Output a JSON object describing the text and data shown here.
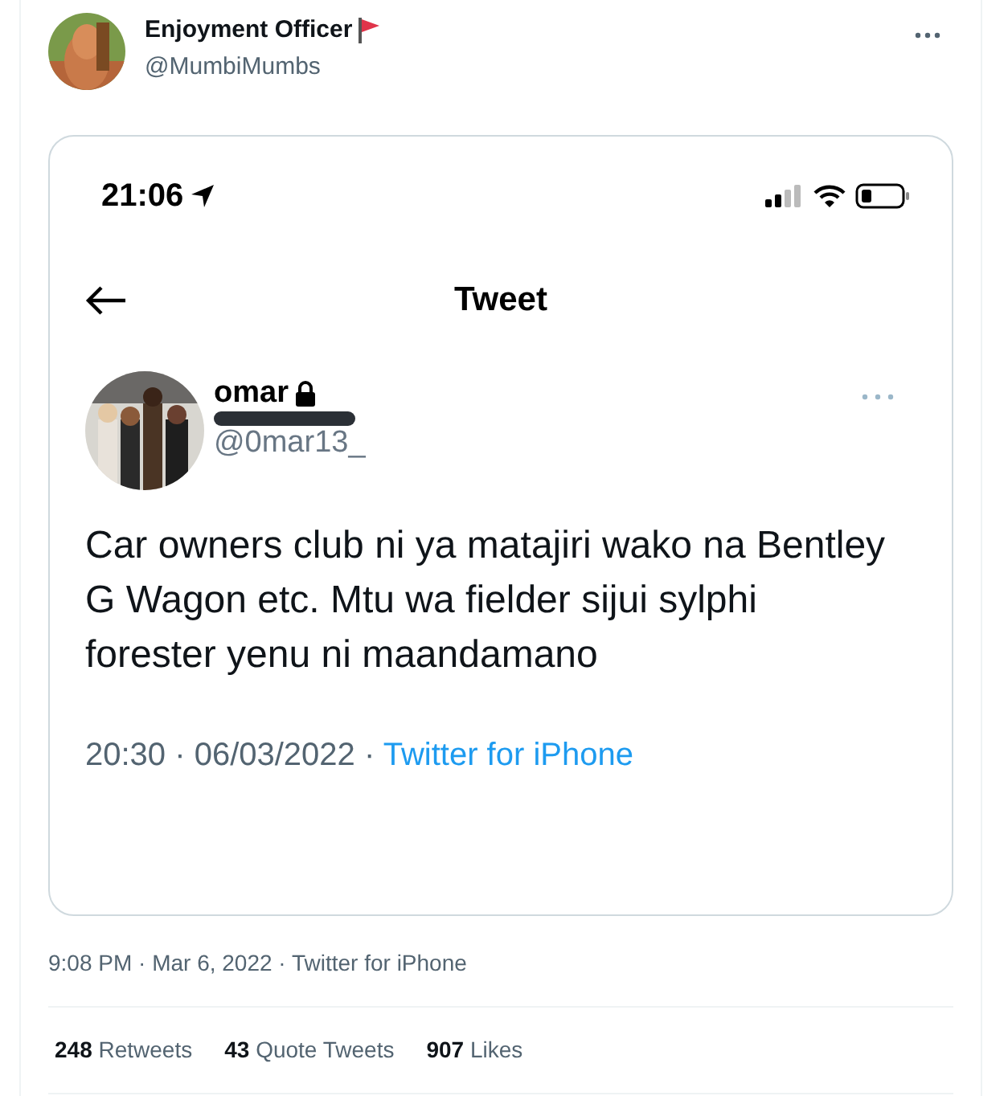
{
  "author": {
    "name": "Enjoyment Officer",
    "handle": "@MumbiMumbs"
  },
  "screenshot": {
    "status_bar": {
      "time": "21:06"
    },
    "header": {
      "title": "Tweet"
    },
    "tweet": {
      "name": "omar",
      "handle": "@0mar13_",
      "text": "Car owners club ni ya matajiri wako na Bentley G Wagon etc. Mtu wa fielder sijui sylphi forester yenu ni maandamano",
      "time": "20:30 · 06/03/2022 · ",
      "source": "Twitter for iPhone"
    }
  },
  "meta": {
    "time": "9:08 PM · Mar 6, 2022 · Twitter for iPhone"
  },
  "stats": [
    {
      "count": "248",
      "label": "Retweets"
    },
    {
      "count": "43",
      "label": "Quote Tweets"
    },
    {
      "count": "907",
      "label": "Likes"
    }
  ]
}
